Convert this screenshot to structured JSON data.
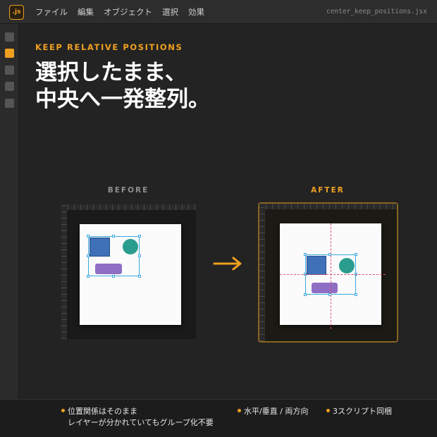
{
  "app": {
    "icon_label": ".js",
    "menu": [
      "ファイル",
      "編集",
      "オブジェクト",
      "選択",
      "効果"
    ],
    "file_name": "center_keep_positions.jsx"
  },
  "toolbar": {
    "tools": [
      {
        "name": "tool-1",
        "active": false
      },
      {
        "name": "tool-2",
        "active": true
      },
      {
        "name": "tool-3",
        "active": false
      },
      {
        "name": "tool-4",
        "active": false
      },
      {
        "name": "tool-5",
        "active": false
      }
    ]
  },
  "hero": {
    "eyebrow": "KEEP RELATIVE POSITIONS",
    "headline_line1": "選択したまま、",
    "headline_line2": "中央へ一発整列。"
  },
  "comparison": {
    "before_label": "BEFORE",
    "after_label": "AFTER",
    "arrow_icon": "arrow-right-icon"
  },
  "features": {
    "item1_line1": "位置関係はそのまま",
    "item1_line2": "レイヤーが分かれていてもグループ化不要",
    "item2": "水平/垂直 / 両方向",
    "item3": "3スクリプト同梱"
  },
  "colors": {
    "accent": "#f0a020",
    "square": "#3e71b8",
    "circle": "#2a9d8f",
    "pill": "#8e6fc4",
    "selection": "#3aa8e0",
    "guide": "#e0507a"
  }
}
